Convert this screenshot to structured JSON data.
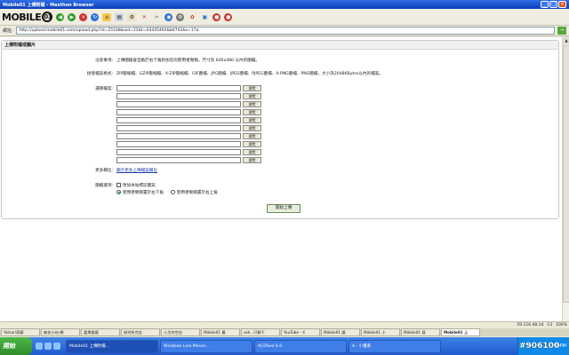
{
  "window": {
    "title": "Mobile01 上傳附檔 - Maxthon Browser"
  },
  "toolbar": {
    "logo_text": "MOBILE",
    "logo_suffix": "01"
  },
  "address": {
    "label": "網址:",
    "url": "http://upload.mobile01.com/upload.php?id=25108&aid=21&t=03435492&b6742&s=17a"
  },
  "panel": {
    "heading": "上傳附檔或圖片",
    "notice_label": "注意事項:",
    "notice_text": "上傳圖檔會自動於右下角附加您的使用者暱稱，尺寸為 640x480 以內的圖檔。",
    "formats_label": "接受檔案格式:",
    "formats_text": "ZIP壓縮檔、GZIP壓縮檔、X-ZIP壓縮檔、GIF圖檔、JPG圖檔、JPEG圖檔、PJPEG圖檔、X-PNG圖檔、PNG圖檔，大小為2048KBytes以內的檔案。",
    "choose_label": "選擇檔案:",
    "browse_label": "瀏覽",
    "more_label": "更多欄位:",
    "more_link": "顯示更多上傳檔案欄位",
    "options_label": "圖檔選項:",
    "opt_watermark": "附加本站標誌圖案",
    "opt_right": "使用者暱稱置於右下角",
    "opt_left": "使用者暱稱置於右上角",
    "submit_label": "開始上傳"
  },
  "status": {
    "ip": "59.116.48.14",
    "zoom": "13",
    "time_info": "100%"
  },
  "tabs": [
    "Yahoo!奇摩",
    "無名小站-網",
    "富果論壇",
    "研究所完全",
    "人生的空白",
    "Mobile01 最",
    "ask...只剩下",
    "YouTube - 4",
    "Mobile01 論",
    "Mobile01 小",
    "Mobile01 發",
    "Mobile01 上"
  ],
  "taskbar": {
    "start": "開始",
    "tasks": [
      "Mobile01 上傳附檔...",
      "Windows Live Messe...",
      "ACDSee 6.0",
      "4 - 小畫家"
    ],
    "clock": "49PM",
    "watermark": "#906100"
  }
}
